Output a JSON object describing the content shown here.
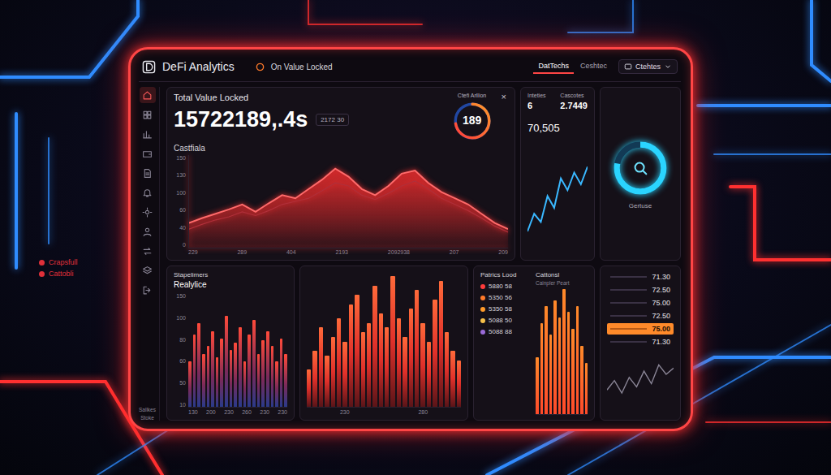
{
  "window": {
    "title": "DeFi Analytics"
  },
  "header": {
    "subtitle": "On Value Locked",
    "tabs": [
      {
        "label": "DatTechs",
        "selected": true
      },
      {
        "label": "Ceshtec",
        "selected": false
      }
    ],
    "dropdown": {
      "label": "Ctehtes"
    }
  },
  "sidebar": {
    "items": [
      {
        "selected": true
      },
      {
        "selected": false
      },
      {
        "selected": false
      },
      {
        "selected": false
      },
      {
        "selected": false
      },
      {
        "selected": false
      },
      {
        "selected": false
      },
      {
        "selected": false
      },
      {
        "selected": false
      },
      {
        "selected": false
      },
      {
        "selected": false
      }
    ],
    "footer": [
      "Sallkes",
      "Stoke"
    ]
  },
  "tvl": {
    "title": "Total Value Locked",
    "value": "15722189,.4s",
    "range": "2172 30",
    "close": "×",
    "chart": {
      "title": "Castfiala",
      "y_ticks": [
        "150",
        "130",
        "100",
        "60",
        "40",
        "0"
      ],
      "x_ticks": [
        "229",
        "289",
        "404",
        "2193",
        "2092938",
        "207",
        "209"
      ],
      "series": [
        [
          40,
          48,
          55,
          62,
          70,
          58,
          72,
          85,
          80,
          95,
          110,
          128,
          115,
          95,
          85,
          100,
          120,
          125,
          105,
          90,
          80,
          70,
          55,
          40,
          30
        ],
        [
          30,
          38,
          45,
          50,
          58,
          52,
          60,
          70,
          75,
          80,
          92,
          105,
          100,
          85,
          78,
          88,
          100,
          108,
          95,
          80,
          70,
          60,
          48,
          35,
          25
        ]
      ]
    }
  },
  "gauge": {
    "label": "Ctefi Arllion",
    "value": "189",
    "level": 0.72
  },
  "stats": {
    "items": [
      {
        "label": "Inteties",
        "value": "6"
      },
      {
        "label": "Cascotes",
        "value": "2.7449"
      }
    ],
    "reading": "70,505",
    "series": [
      20,
      35,
      28,
      50,
      40,
      65,
      55,
      70,
      60,
      75
    ]
  },
  "donut": {
    "label": "Gertuse",
    "level": 0.78
  },
  "bars_left": {
    "title": "Stapelimers",
    "subtitle": "Realylice",
    "y_ticks": [
      "150",
      "100",
      "80",
      "60",
      "50",
      "10"
    ],
    "x_ticks": [
      "130",
      "200",
      "230",
      "260",
      "230",
      "230"
    ],
    "values": [
      60,
      95,
      110,
      70,
      80,
      100,
      65,
      90,
      120,
      75,
      85,
      105,
      60,
      95,
      115,
      70,
      88,
      100,
      80,
      60,
      90,
      70
    ]
  },
  "bars_center": {
    "x_ticks": [
      "230",
      "280"
    ],
    "values": [
      40,
      60,
      85,
      55,
      75,
      95,
      70,
      110,
      120,
      80,
      90,
      130,
      100,
      85,
      140,
      95,
      75,
      105,
      125,
      90,
      70,
      115,
      135,
      80,
      60,
      50
    ]
  },
  "pool_list": {
    "title": "Patrics Lood",
    "items": [
      {
        "label": "5880 58",
        "color": "#ff3b3b"
      },
      {
        "label": "5350 56",
        "color": "#ff7a2a"
      },
      {
        "label": "5350 58",
        "color": "#ff9a2a"
      },
      {
        "label": "5088 50",
        "color": "#f5c04a"
      },
      {
        "label": "5088 88",
        "color": "#9a6bd8"
      }
    ]
  },
  "bars_orange": {
    "title": "Cattonsl",
    "caption": "Cainpler Peart",
    "values": [
      50,
      80,
      95,
      70,
      100,
      85,
      110,
      90,
      75,
      95,
      60,
      45
    ]
  },
  "price_table": {
    "rows": [
      {
        "value": "71.30",
        "selected": false
      },
      {
        "value": "72.50",
        "selected": false
      },
      {
        "value": "75.00",
        "selected": false
      },
      {
        "value": "72.50",
        "selected": false
      },
      {
        "value": "75.00",
        "selected": true
      },
      {
        "value": "71.30",
        "selected": false
      }
    ]
  },
  "mini_chart": {
    "values": [
      40,
      55,
      35,
      60,
      45,
      70,
      50,
      80,
      65,
      75
    ]
  },
  "background_panel": {
    "items": [
      {
        "label": "Crapsfull",
        "color": "#e0303a"
      },
      {
        "label": "Cattobli",
        "color": "#e0303a"
      }
    ]
  }
}
